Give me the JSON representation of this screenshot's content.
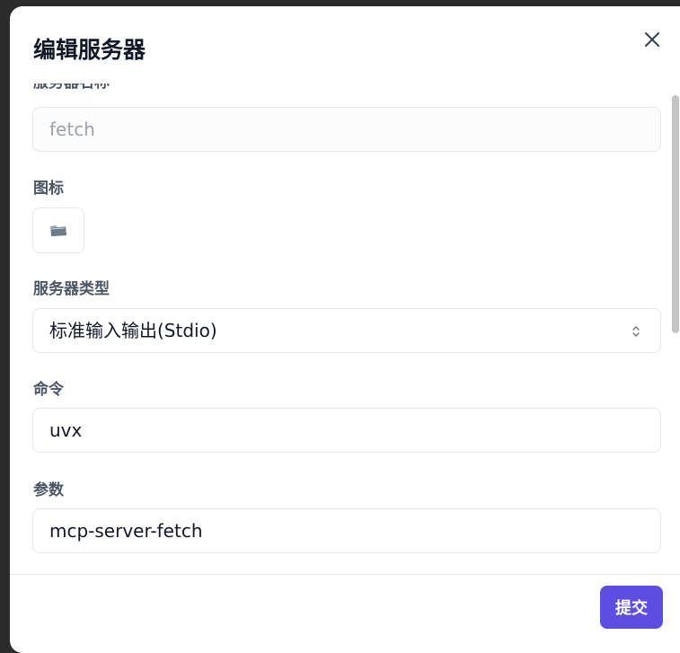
{
  "dialog": {
    "title": "编辑服务器",
    "close_icon": "close-icon"
  },
  "form": {
    "server_name": {
      "label": "服务器名称",
      "value": "fetch",
      "disabled": true
    },
    "icon": {
      "label": "图标",
      "value_icon": "folder-icon"
    },
    "server_type": {
      "label": "服务器类型",
      "selected": "标准输入输出(Stdio)",
      "indicator_icon": "chevron-up-down-icon"
    },
    "command": {
      "label": "命令",
      "value": "uvx"
    },
    "arguments": {
      "label": "参数",
      "value": "mcp-server-fetch"
    }
  },
  "footer": {
    "submit_label": "提交"
  },
  "colors": {
    "accent": "#5b4ee0",
    "label": "#4b5563",
    "border": "#e5e7eb",
    "scrollbar": "#c4c4c4"
  }
}
